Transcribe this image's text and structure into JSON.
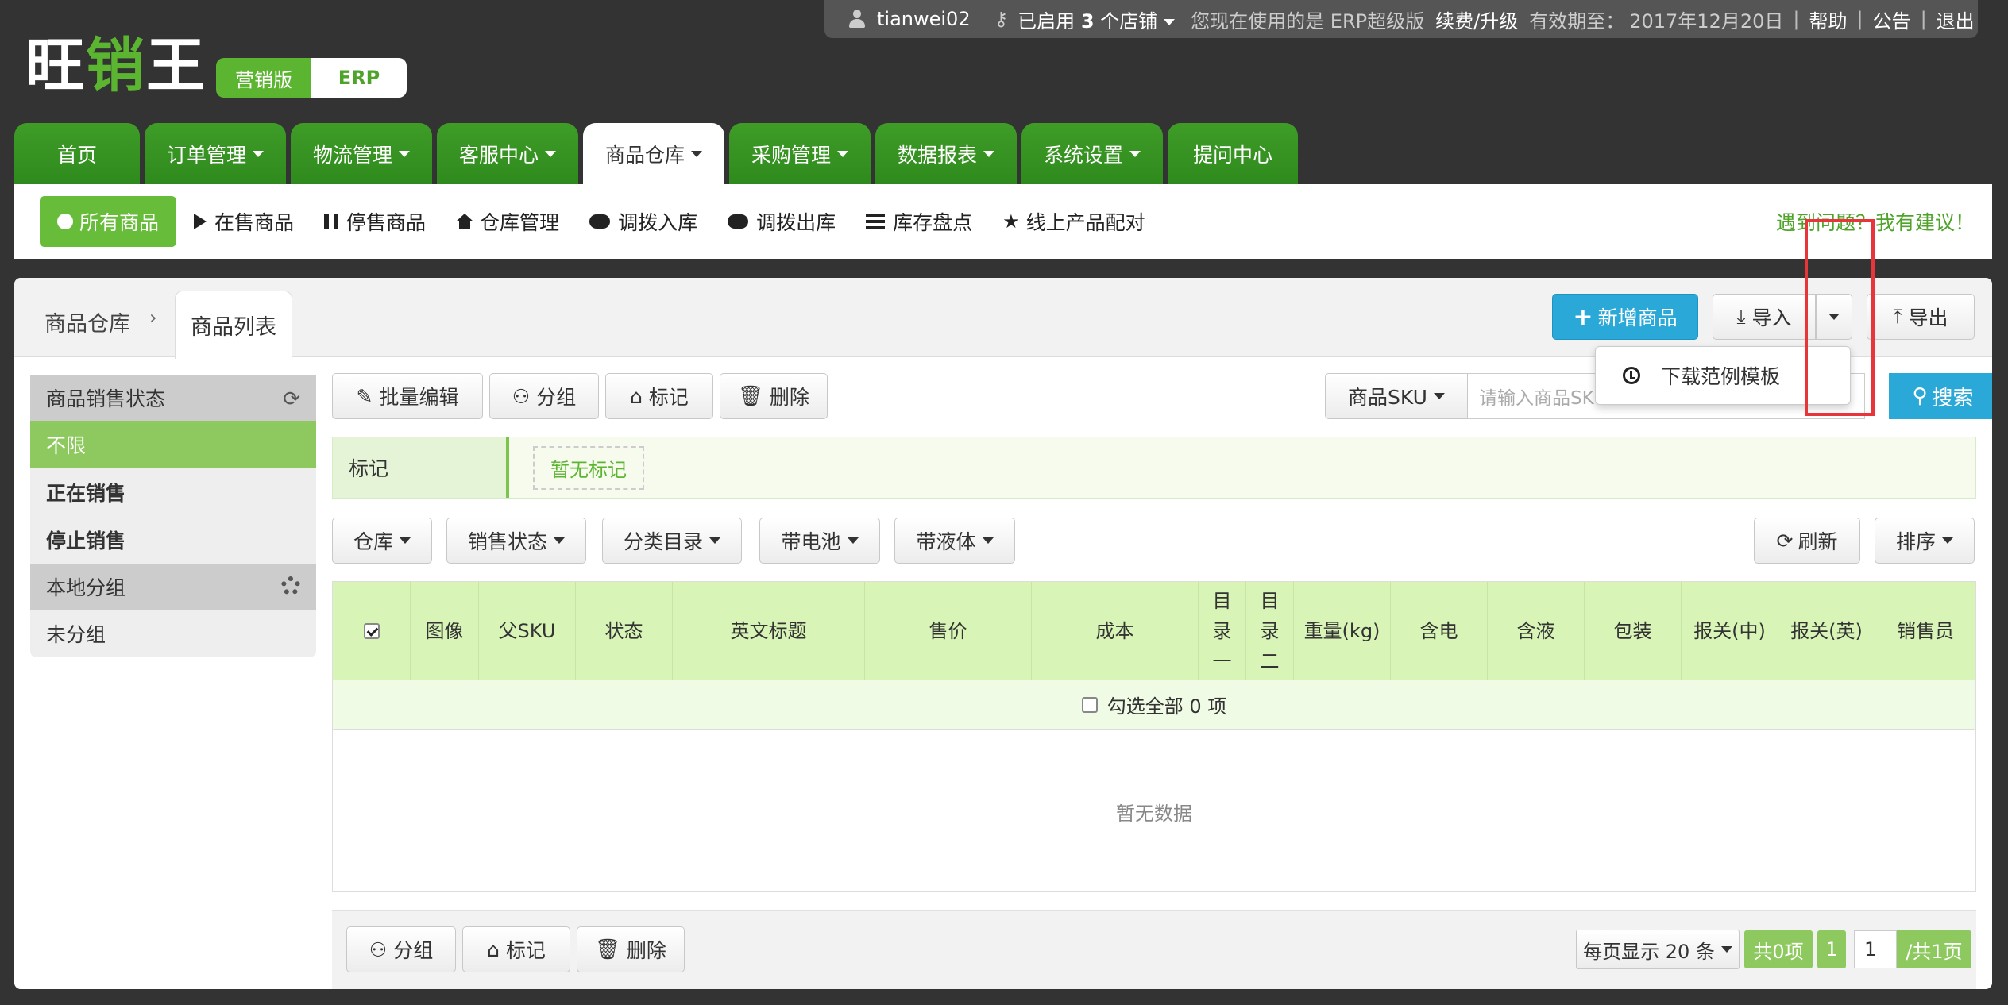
{
  "topbar": {
    "username": "tianwei02",
    "stores_prefix": "已启用",
    "stores_count": "3",
    "stores_suffix": "个店铺",
    "version_text": "您现在使用的是 ERP超级版",
    "upgrade": "续费/升级",
    "valid_label": "有效期至：",
    "valid_date": "2017年12月20日",
    "help": "帮助",
    "notice": "公告",
    "logout": "退出"
  },
  "logo": {
    "part1": "旺",
    "part2": "销",
    "part3": "王"
  },
  "edition": {
    "marketing": "营销版",
    "erp": "ERP"
  },
  "nav": [
    {
      "label": "首页",
      "dropdown": false
    },
    {
      "label": "订单管理",
      "dropdown": true
    },
    {
      "label": "物流管理",
      "dropdown": true
    },
    {
      "label": "客服中心",
      "dropdown": true
    },
    {
      "label": "商品仓库",
      "dropdown": true,
      "active": true
    },
    {
      "label": "采购管理",
      "dropdown": true
    },
    {
      "label": "数据报表",
      "dropdown": true
    },
    {
      "label": "系统设置",
      "dropdown": true
    },
    {
      "label": "提问中心",
      "dropdown": false
    }
  ],
  "subnav": {
    "all": "所有商品",
    "on_sale": "在售商品",
    "stopped": "停售商品",
    "warehouse": "仓库管理",
    "transfer_in": "调拨入库",
    "transfer_out": "调拨出库",
    "inventory": "库存盘点",
    "match": "线上产品配对",
    "help_link": "遇到问题？我有建议！"
  },
  "breadcrumb": {
    "root": "商品仓库",
    "current": "商品列表"
  },
  "actions": {
    "add": "新增商品",
    "import": "导入",
    "export": "导出",
    "download_template": "下载范例模板"
  },
  "sidebar": {
    "status_header": "商品销售状态",
    "status_items": [
      "不限",
      "正在销售",
      "停止销售"
    ],
    "group_header": "本地分组",
    "group_items": [
      "未分组"
    ]
  },
  "toolbar": {
    "batch_edit": "批量编辑",
    "group": "分组",
    "mark": "标记",
    "delete": "删除"
  },
  "search": {
    "field": "商品SKU",
    "placeholder": "请输入商品SKU",
    "button": "搜索"
  },
  "marks": {
    "label": "标记",
    "none": "暂无标记"
  },
  "filters": {
    "warehouse": "仓库",
    "sale_status": "销售状态",
    "category": "分类目录",
    "battery": "带电池",
    "liquid": "带液体",
    "refresh": "刷新",
    "sort": "排序"
  },
  "table": {
    "headers": [
      "图像",
      "父SKU",
      "状态",
      "英文标题",
      "售价",
      "成本",
      "目录一",
      "目录二",
      "重量(kg)",
      "含电",
      "含液",
      "包装",
      "报关(中)",
      "报关(英)",
      "销售员"
    ],
    "select_all": "勾选全部 0 项",
    "empty": "暂无数据"
  },
  "pagination": {
    "per_page": "每页显示 20 条",
    "total": "共0项",
    "current": "1",
    "input": "1",
    "pages": "/共1页"
  }
}
